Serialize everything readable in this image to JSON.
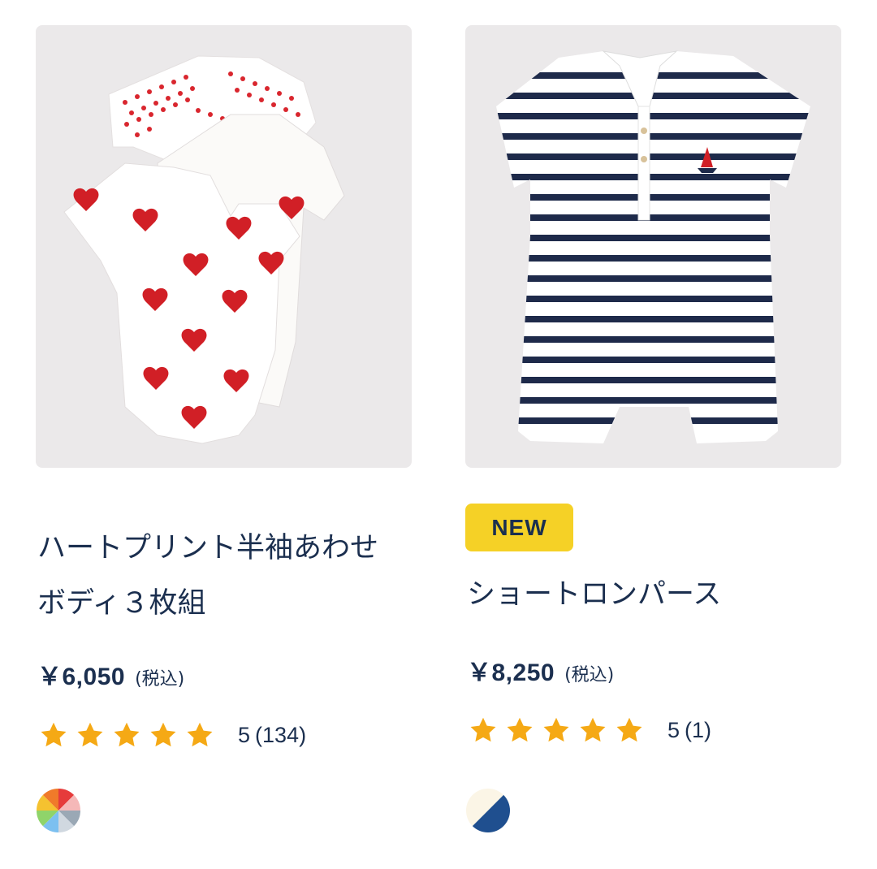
{
  "products": [
    {
      "image_alt": "heart-print-bodysuits-image",
      "badge": "",
      "title_line1": "ハートプリント半袖あわせ",
      "title_line2": "ボディ３枚組",
      "price": "￥6,050",
      "tax_label": "(税込)",
      "rating": "5",
      "review_count": "(134)",
      "stars": 5
    },
    {
      "image_alt": "striped-short-romper-image",
      "badge": "NEW",
      "title_line1": "ショートロンパース",
      "price": "￥8,250",
      "tax_label": "(税込)",
      "rating": "5",
      "review_count": "(1)",
      "stars": 5
    }
  ],
  "colors": {
    "text": "#1b2f4f",
    "star": "#f5a915",
    "badge": "#f5d126",
    "image_bg": "#ebe9ea"
  }
}
